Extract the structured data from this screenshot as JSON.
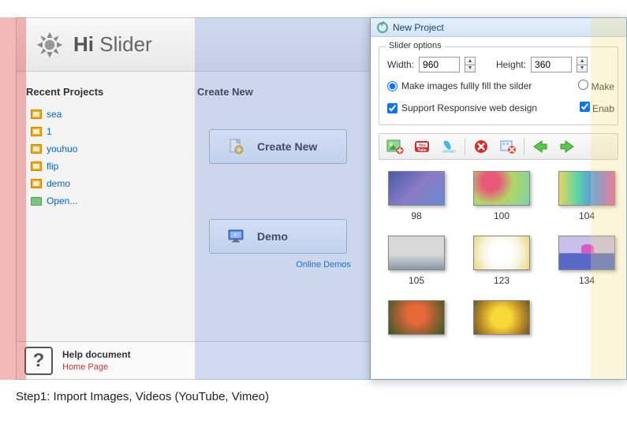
{
  "logo": {
    "name": "Hi Slider",
    "hi": "Hi",
    "slider": "Slider"
  },
  "recent": {
    "title": "Recent Projects",
    "items": [
      "sea",
      "1",
      "youhuo",
      "flip",
      "demo"
    ],
    "open": "Open..."
  },
  "createPanel": {
    "title": "Create New",
    "createBtn": "Create New",
    "demoBtn": "Demo",
    "onlineDemos": "Online Demos"
  },
  "help": {
    "title": "Help document",
    "link": "Home Page"
  },
  "dialog": {
    "title": "New Project",
    "optionsLegend": "Slider options",
    "widthLabel": "Width:",
    "widthValue": "960",
    "heightLabel": "Height:",
    "heightValue": "360",
    "fillRadio": "Make images fullly fill the silder",
    "makeRadioCut": "Make",
    "responsiveCheck": "Support Responsive web design",
    "enabCheckCut": "Enab"
  },
  "thumbs": [
    {
      "label": "98",
      "cls": "t1"
    },
    {
      "label": "100",
      "cls": "t2"
    },
    {
      "label": "104",
      "cls": "t3"
    },
    {
      "label": "105",
      "cls": "t4"
    },
    {
      "label": "123",
      "cls": "t5"
    },
    {
      "label": "134",
      "cls": "t6"
    },
    {
      "label": "",
      "cls": "t7"
    },
    {
      "label": "",
      "cls": "t8"
    }
  ],
  "caption": "Step1: Import Images, Videos (YouTube, Vimeo)"
}
